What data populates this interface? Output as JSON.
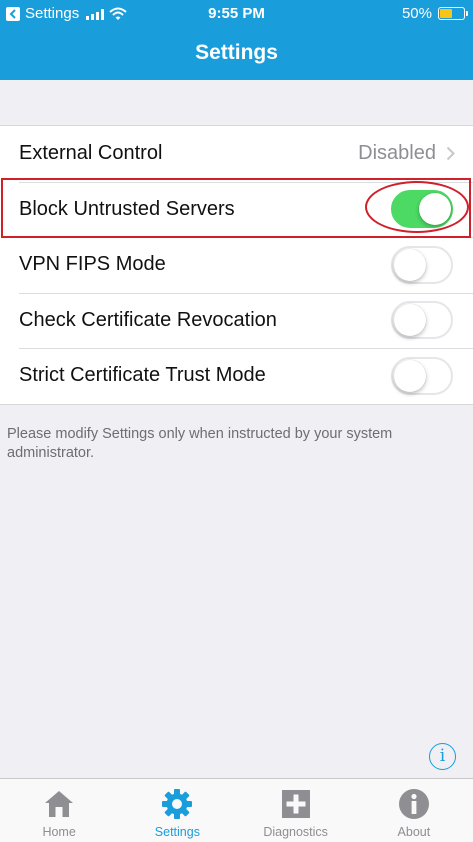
{
  "status_bar": {
    "back_app": "Settings",
    "time": "9:55 PM",
    "battery": "50%",
    "battery_level": 0.5,
    "battery_color": "#f5c518"
  },
  "nav": {
    "title": "Settings",
    "background": "#1a9ddb"
  },
  "settings": {
    "external_control": {
      "label": "External Control",
      "value": "Disabled"
    },
    "block_untrusted": {
      "label": "Block Untrusted Servers",
      "on": true
    },
    "vpn_fips": {
      "label": "VPN FIPS Mode",
      "on": false
    },
    "check_revocation": {
      "label": "Check Certificate Revocation",
      "on": false
    },
    "strict_trust": {
      "label": "Strict Certificate Trust Mode",
      "on": false
    }
  },
  "note": "Please modify Settings only when instructed by your system administrator.",
  "info_glyph": "i",
  "tabs": [
    {
      "label": "Home",
      "icon": "home-icon",
      "active": false
    },
    {
      "label": "Settings",
      "icon": "gear-icon",
      "active": true
    },
    {
      "label": "Diagnostics",
      "icon": "plus-box-icon",
      "active": false
    },
    {
      "label": "About",
      "icon": "info-circle-icon",
      "active": false
    }
  ],
  "colors": {
    "accent": "#1a9ddb",
    "toggle_on": "#4cd964",
    "highlight": "#d0202a"
  }
}
